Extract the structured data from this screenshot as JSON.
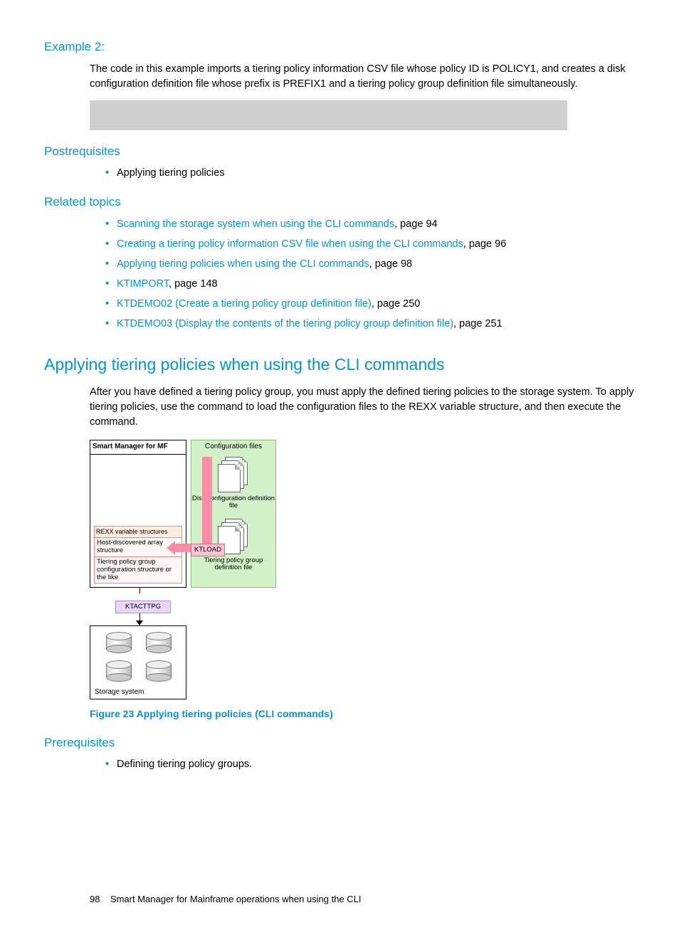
{
  "example2": {
    "heading": "Example 2:",
    "body": "The code in this example imports a tiering policy information CSV file whose policy ID is POLICY1, and creates a disk configuration definition file whose prefix is PREFIX1 and a tiering policy group definition file simultaneously."
  },
  "postreq": {
    "heading": "Postrequisites",
    "items": [
      "Applying tiering policies"
    ]
  },
  "related": {
    "heading": "Related topics",
    "items": [
      {
        "link": "Scanning the storage system when using the CLI commands",
        "tail": ", page 94"
      },
      {
        "link": "Creating a tiering policy information CSV file when using the CLI commands",
        "tail": ", page 96"
      },
      {
        "link": "Applying tiering policies when using the CLI commands",
        "tail": ", page 98"
      },
      {
        "link": "KTIMPORT",
        "tail": ", page 148"
      },
      {
        "link": "KTDEMO02 (Create a tiering policy group definition file)",
        "tail": ", page 250"
      },
      {
        "link": "KTDEMO03 (Display the contents of the tiering policy group definition file)",
        "tail": ", page 251"
      }
    ]
  },
  "section": {
    "heading": "Applying tiering policies when using the CLI commands",
    "body_a": "After you have defined a tiering policy group, you must apply the defined tiering policies to the storage system. To apply tiering policies, use the ",
    "body_b": " command to load the configuration files to the REXX variable structure, and then execute the ",
    "body_c": " command."
  },
  "diagram": {
    "smf_title": "Smart Manager for MF",
    "rexx_title": "REXX variable structures",
    "rexx_rows": [
      "Host-discovered array structure",
      "Tiering policy group configuration structure or the like"
    ],
    "config_panel_title": "Configuration files",
    "file1": "Disk configuration definition file",
    "file2": "Tiering policy group definition file",
    "ktload": "KTLOAD",
    "ktacttpg": "KTACTTPG",
    "storage_label": "Storage system"
  },
  "figure_caption": "Figure 23 Applying tiering policies (CLI commands)",
  "prereq": {
    "heading": "Prerequisites",
    "items": [
      "Defining tiering policy groups."
    ]
  },
  "footer": {
    "page": "98",
    "text": "Smart Manager for Mainframe operations when using the CLI"
  }
}
